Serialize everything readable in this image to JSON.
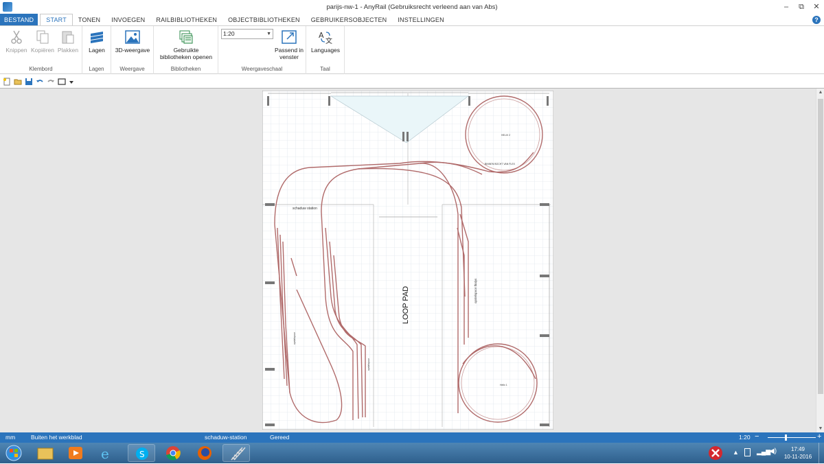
{
  "window": {
    "title": "parijs-nw-1 - AnyRail (Gebruiksrecht verleend aan van Abs)",
    "minimize": "–",
    "restore": "⧉",
    "close": "✕"
  },
  "menu": {
    "file": "BESTAND",
    "tabs": [
      "START",
      "TONEN",
      "INVOEGEN",
      "RAILBIBLIOTHEKEN",
      "OBJECTBIBLIOTHEKEN",
      "GEBRUIKERSOBJECTEN",
      "INSTELLINGEN"
    ],
    "help": "?"
  },
  "ribbon": {
    "clipboard": {
      "cut": "Knippen",
      "copy": "Kopiëren",
      "paste": "Plakken",
      "label": "Klembord"
    },
    "layers": {
      "button": "Lagen",
      "label": "Lagen"
    },
    "view": {
      "button": "3D-weergave",
      "label": "Weergave"
    },
    "libraries": {
      "button_line1": "Gebruikte",
      "button_line2": "bibliotheken openen",
      "label": "Bibliotheken"
    },
    "scale": {
      "value": "1:20",
      "fit_line1": "Passend in",
      "fit_line2": "venster",
      "label": "Weergaveschaal"
    },
    "language": {
      "button": "Languages",
      "label": "Taal"
    }
  },
  "plan": {
    "helix_top": "HELIX 2",
    "helix_bottom": "Helix 1",
    "flex_bend": "BINNEN BOCHT VAN FLEX",
    "shadow_station": "schaduw station",
    "loop": "LOOP PAD",
    "siding_right": "opstelspoor thalys",
    "siding_left": "opstelspoor",
    "siding_mid": "opstelspoor"
  },
  "status": {
    "unit": "mm",
    "position": "Buiten het werkblad",
    "layer": "schaduw-station",
    "state": "Gereed",
    "zoom": "1:20"
  },
  "clock": {
    "time": "17:49",
    "date": "10-11-2016"
  },
  "colors": {
    "accent": "#2b74bc",
    "track": "#b06a6a"
  }
}
